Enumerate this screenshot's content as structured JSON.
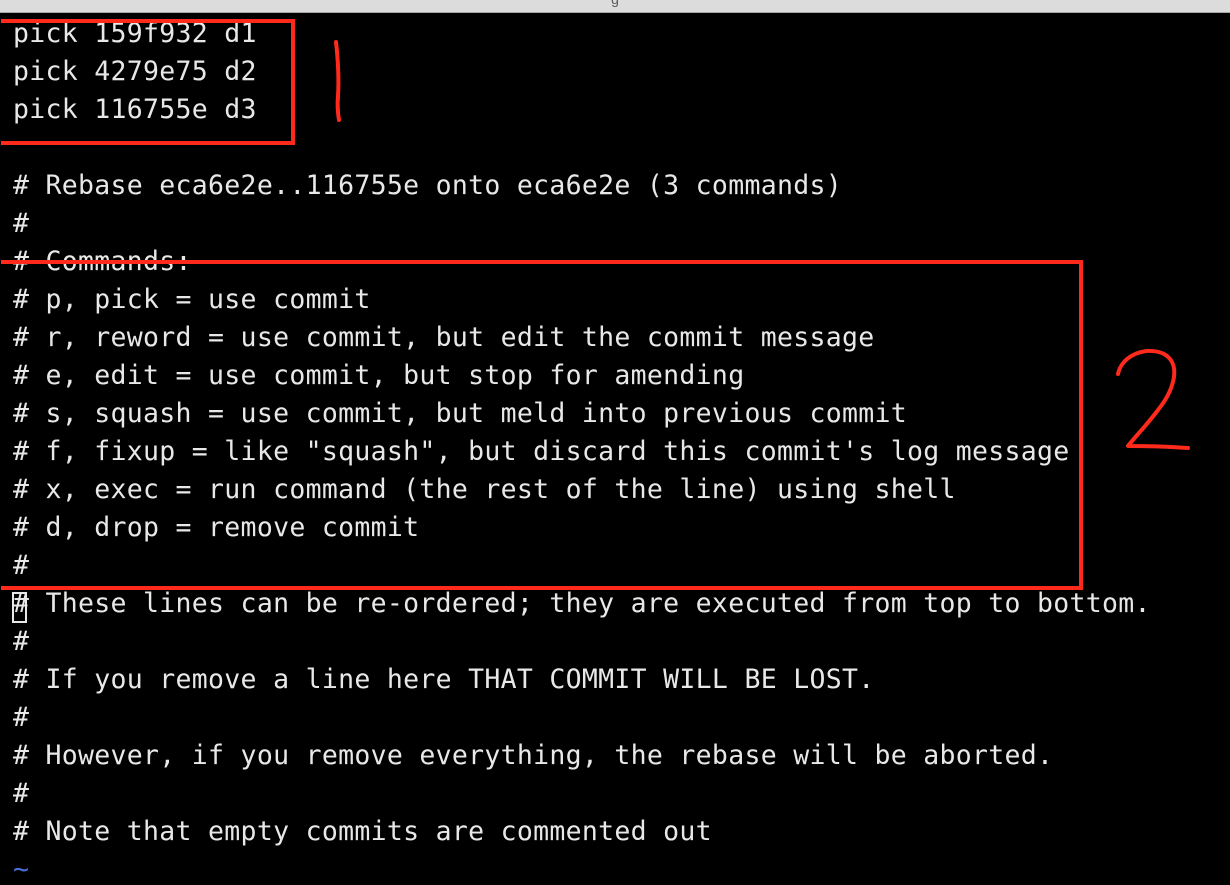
{
  "window": {
    "title": "g"
  },
  "editor": {
    "lines": [
      "pick 159f932 d1",
      "pick 4279e75 d2",
      "pick 116755e d3",
      "",
      "# Rebase eca6e2e..116755e onto eca6e2e (3 commands)",
      "#",
      "# Commands:",
      "# p, pick = use commit",
      "# r, reword = use commit, but edit the commit message",
      "# e, edit = use commit, but stop for amending",
      "# s, squash = use commit, but meld into previous commit",
      "# f, fixup = like \"squash\", but discard this commit's log message",
      "# x, exec = run command (the rest of the line) using shell",
      "# d, drop = remove commit",
      "#",
      "# These lines can be re-ordered; they are executed from top to bottom.",
      "#",
      "# If you remove a line here THAT COMMIT WILL BE LOST.",
      "#",
      "# However, if you remove everything, the rebase will be aborted.",
      "#",
      "# Note that empty commits are commented out",
      "~"
    ]
  },
  "annotations": {
    "box_color": "#ff2a1c",
    "label_1": "1",
    "label_2": "2"
  }
}
